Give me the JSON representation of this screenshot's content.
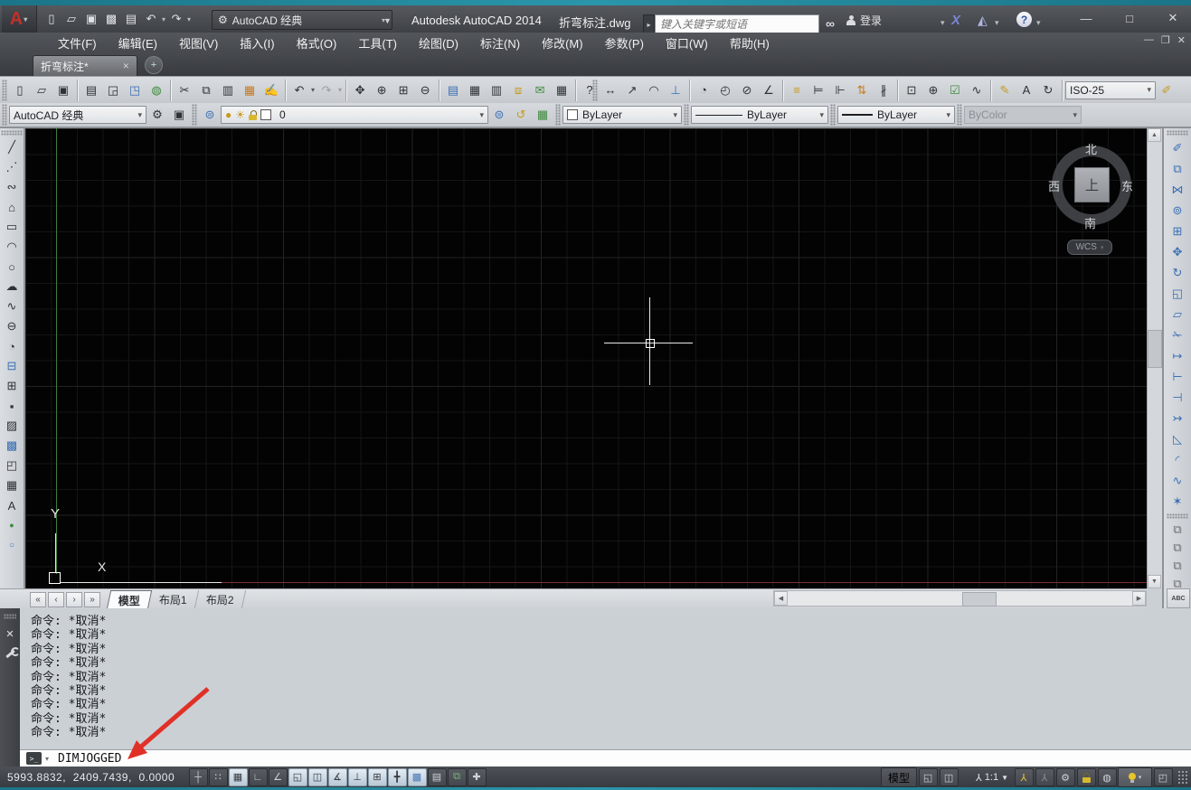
{
  "titlebar": {
    "app_title": "Autodesk AutoCAD 2014",
    "doc_title": "折弯标注.dwg",
    "workspace": "AutoCAD 经典",
    "search_placeholder": "键入关键字或短语",
    "signin": "登录"
  },
  "menubar": {
    "items": [
      "文件(F)",
      "编辑(E)",
      "视图(V)",
      "插入(I)",
      "格式(O)",
      "工具(T)",
      "绘图(D)",
      "标注(N)",
      "修改(M)",
      "参数(P)",
      "窗口(W)",
      "帮助(H)"
    ]
  },
  "filetab": {
    "label": "折弯标注*"
  },
  "toolbars": {
    "dim_style_value": "ISO-25",
    "workspace_value": "AutoCAD 经典",
    "layer_value": "0",
    "color_value": "ByLayer",
    "linetype_value": "ByLayer",
    "lineweight_value": "ByLayer",
    "plotstyle_value": "ByColor"
  },
  "viewcube": {
    "north": "北",
    "south": "南",
    "west": "西",
    "east": "东",
    "top": "上",
    "wcs": "WCS"
  },
  "ucs": {
    "x": "X",
    "y": "Y"
  },
  "layout_bar": {
    "model": "模型",
    "layout1": "布局1",
    "layout2": "布局2"
  },
  "command": {
    "history": [
      "命令: *取消*",
      "命令: *取消*",
      "命令: *取消*",
      "命令: *取消*",
      "命令: *取消*",
      "命令: *取消*",
      "命令: *取消*",
      "命令: *取消*",
      "命令: *取消*"
    ],
    "prompt": ">_",
    "input": "DIMJOGGED"
  },
  "statusbar": {
    "coordinates": "5993.8832,  2409.7439,  0.0000",
    "model_label": "模型",
    "annotation_scale": "1:1"
  },
  "colors": {
    "accent_teal": "#1b7487",
    "canvas_bg": "#030304",
    "grid_line": "#151515",
    "axis_green": "#3f7d3f",
    "axis_red": "#7d2f2f",
    "crosshair": "#ffffff",
    "arrow_red": "#e03127",
    "toolbar_bg": "#ced2d7",
    "statusbar_bg": "#3d4147"
  },
  "icons": {
    "app_logo": "A",
    "caret": "▾",
    "caret_down": "▼",
    "expand": "▸",
    "new": "▯",
    "open": "▱",
    "save": "▣",
    "save_as": "▩",
    "plot": "▤",
    "undo": "↶",
    "redo": "↷",
    "gear": "⚙",
    "binoculars": "∞",
    "exchange_x": "X",
    "a360": "◭",
    "help": "?",
    "win_min": "—",
    "win_max": "□",
    "win_close": "✕",
    "doc_min": "—",
    "doc_restore": "❐",
    "doc_close": "✕",
    "tab_close": "✕",
    "tab_new": "+",
    "preview": "◲",
    "publish": "◳",
    "dwf": "◍",
    "cut": "✂",
    "copy": "⧉",
    "paste": "▥",
    "paste_special": "▦",
    "match_props": "✍",
    "pan": "✥",
    "zoom_rt": "⊕",
    "zoom_win": "⊞",
    "zoom_prev": "⊖",
    "properties": "▤",
    "design_center": "▦",
    "tool_palettes": "▥",
    "sheet_set": "⧈",
    "markup": "✉",
    "quick_calc": "▦",
    "dim_linear": "↔",
    "dim_aligned": "↗",
    "dim_arc": "◠",
    "dim_ordinate": "⊥",
    "dim_radius": "◔",
    "dim_jogged": "◴",
    "dim_diameter": "⊘",
    "dim_angular": "∠",
    "dim_quick": "≡",
    "dim_baseline": "⊨",
    "dim_continue": "⊩",
    "dim_space": "⇅",
    "dim_break": "∦",
    "dim_tolerance": "⊡",
    "dim_center": "⊕",
    "dim_inspect": "☑",
    "dim_jogline": "∿",
    "dim_edit": "✎",
    "dim_text_edit": "A",
    "dim_update": "↻",
    "dim_brush": "✐",
    "layer_props": "⊜",
    "layer_bulb": "●",
    "layer_sun": "☀",
    "layer_make_current": "⊜",
    "layer_previous": "↺",
    "layer_states": "▦",
    "line": "╱",
    "xline": "⋰",
    "pline": "∾",
    "polygon": "⌂",
    "rectangle": "▭",
    "arc": "◠",
    "circle": "○",
    "revcloud": "☁",
    "spline": "∿",
    "ellipse": "⊖",
    "ellipse_arc": "◔",
    "insert_block": "⊟",
    "make_block": "⊞",
    "point": "▪",
    "hatch": "▨",
    "gradient": "▩",
    "region": "◰",
    "table": "▦",
    "mtext": "A",
    "extra_green": "●",
    "extra_blue": "○",
    "erase": "✐",
    "mod_copy": "⧉",
    "mirror": "⋈",
    "offset": "⊚",
    "array": "⊞",
    "move": "✥",
    "rotate": "↻",
    "scale": "◱",
    "stretch": "▱",
    "trim": "✁",
    "extend": "↦",
    "break_pt": "⊢",
    "break": "⊣",
    "join": "↣",
    "chamfer": "◺",
    "fillet": "◜",
    "blend": "∿",
    "explode": "✶",
    "do_front": "⧉",
    "do_back": "⧉",
    "do_above": "⧉",
    "do_under": "⧉",
    "spell": "ABC",
    "st_infer": "┼",
    "st_snap": "∷",
    "st_grid": "▦",
    "st_ortho": "∟",
    "st_polar": "∠",
    "st_osnap": "◱",
    "st_osnap3d": "◫",
    "st_otrack": "∡",
    "st_ducs": "⊥",
    "st_dyn": "⊞",
    "st_lwt": "╋",
    "st_transp": "▩",
    "st_qp": "▤",
    "st_sc": "⧉",
    "st_am": "✚",
    "qv_layouts": "◱",
    "qv_drawings": "◫",
    "person": "⅄",
    "annot_vis": "⅄",
    "annot_auto": "⅄",
    "perf": "◍",
    "clean": "◰",
    "nav_first": "«",
    "nav_prev": "‹",
    "nav_next": "›",
    "nav_last": "»",
    "up": "▲",
    "down": "▼",
    "left": "◀",
    "right": "▶",
    "cmd_close": "✕"
  }
}
